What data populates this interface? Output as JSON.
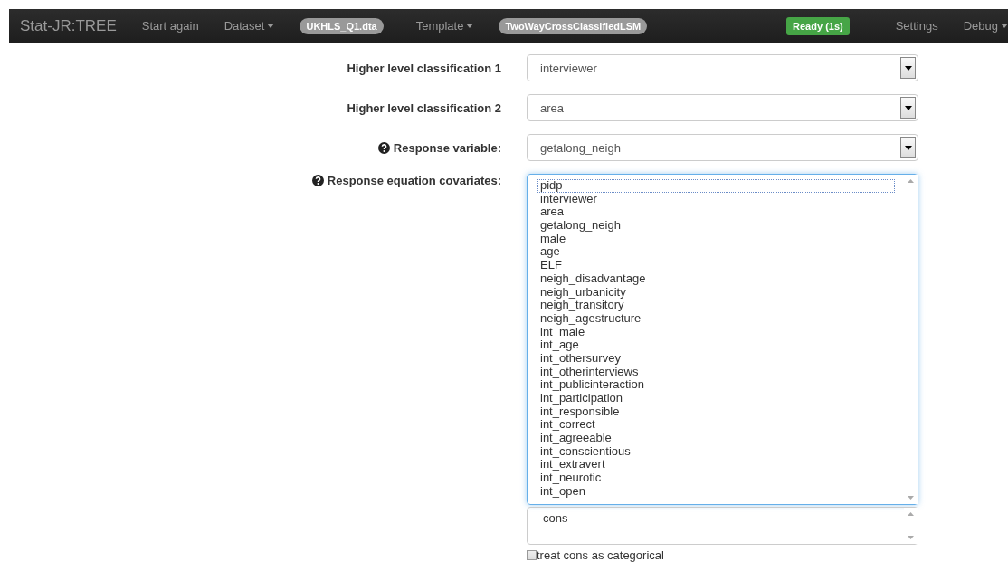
{
  "navbar": {
    "brand": "Stat-JR:TREE",
    "items": [
      {
        "kind": "link",
        "label": "Start again"
      },
      {
        "kind": "dropdown",
        "label": "Dataset"
      },
      {
        "kind": "badge",
        "label": "UKHLS_Q1.dta"
      },
      {
        "kind": "dropdown",
        "label": "Template"
      },
      {
        "kind": "badge",
        "label": "TwoWayCrossClassifiedLSM"
      },
      {
        "kind": "status",
        "label": "Ready (1s)"
      },
      {
        "kind": "link",
        "label": "Settings"
      },
      {
        "kind": "dropdown",
        "label": "Debug"
      }
    ]
  },
  "fields": [
    {
      "label": "Higher level classification 1",
      "help": false,
      "value": "interviewer"
    },
    {
      "label": "Higher level classification 2",
      "help": false,
      "value": "area"
    },
    {
      "label": "Response variable:",
      "help": true,
      "value": "getalong_neigh"
    }
  ],
  "covariates": {
    "label": "Response equation covariates:",
    "help": true,
    "options": [
      {
        "label": "pidp",
        "focused": true
      },
      {
        "label": "interviewer",
        "focused": false
      },
      {
        "label": "area",
        "focused": false
      },
      {
        "label": "getalong_neigh",
        "focused": false
      },
      {
        "label": "male",
        "focused": false
      },
      {
        "label": "age",
        "focused": false
      },
      {
        "label": "ELF",
        "focused": false
      },
      {
        "label": "neigh_disadvantage",
        "focused": false
      },
      {
        "label": "neigh_urbanicity",
        "focused": false
      },
      {
        "label": "neigh_transitory",
        "focused": false
      },
      {
        "label": "neigh_agestructure",
        "focused": false
      },
      {
        "label": "int_male",
        "focused": false
      },
      {
        "label": "int_age",
        "focused": false
      },
      {
        "label": "int_othersurvey",
        "focused": false
      },
      {
        "label": "int_otherinterviews",
        "focused": false
      },
      {
        "label": "int_publicinteraction",
        "focused": false
      },
      {
        "label": "int_participation",
        "focused": false
      },
      {
        "label": "int_responsible",
        "focused": false
      },
      {
        "label": "int_correct",
        "focused": false
      },
      {
        "label": "int_agreeable",
        "focused": false
      },
      {
        "label": "int_conscientious",
        "focused": false
      },
      {
        "label": "int_extravert",
        "focused": false
      },
      {
        "label": "int_neurotic",
        "focused": false
      },
      {
        "label": "int_open",
        "focused": false
      }
    ],
    "fixed": [
      "cons"
    ],
    "checkbox": {
      "label": "treat cons as categorical",
      "checked": false
    }
  }
}
